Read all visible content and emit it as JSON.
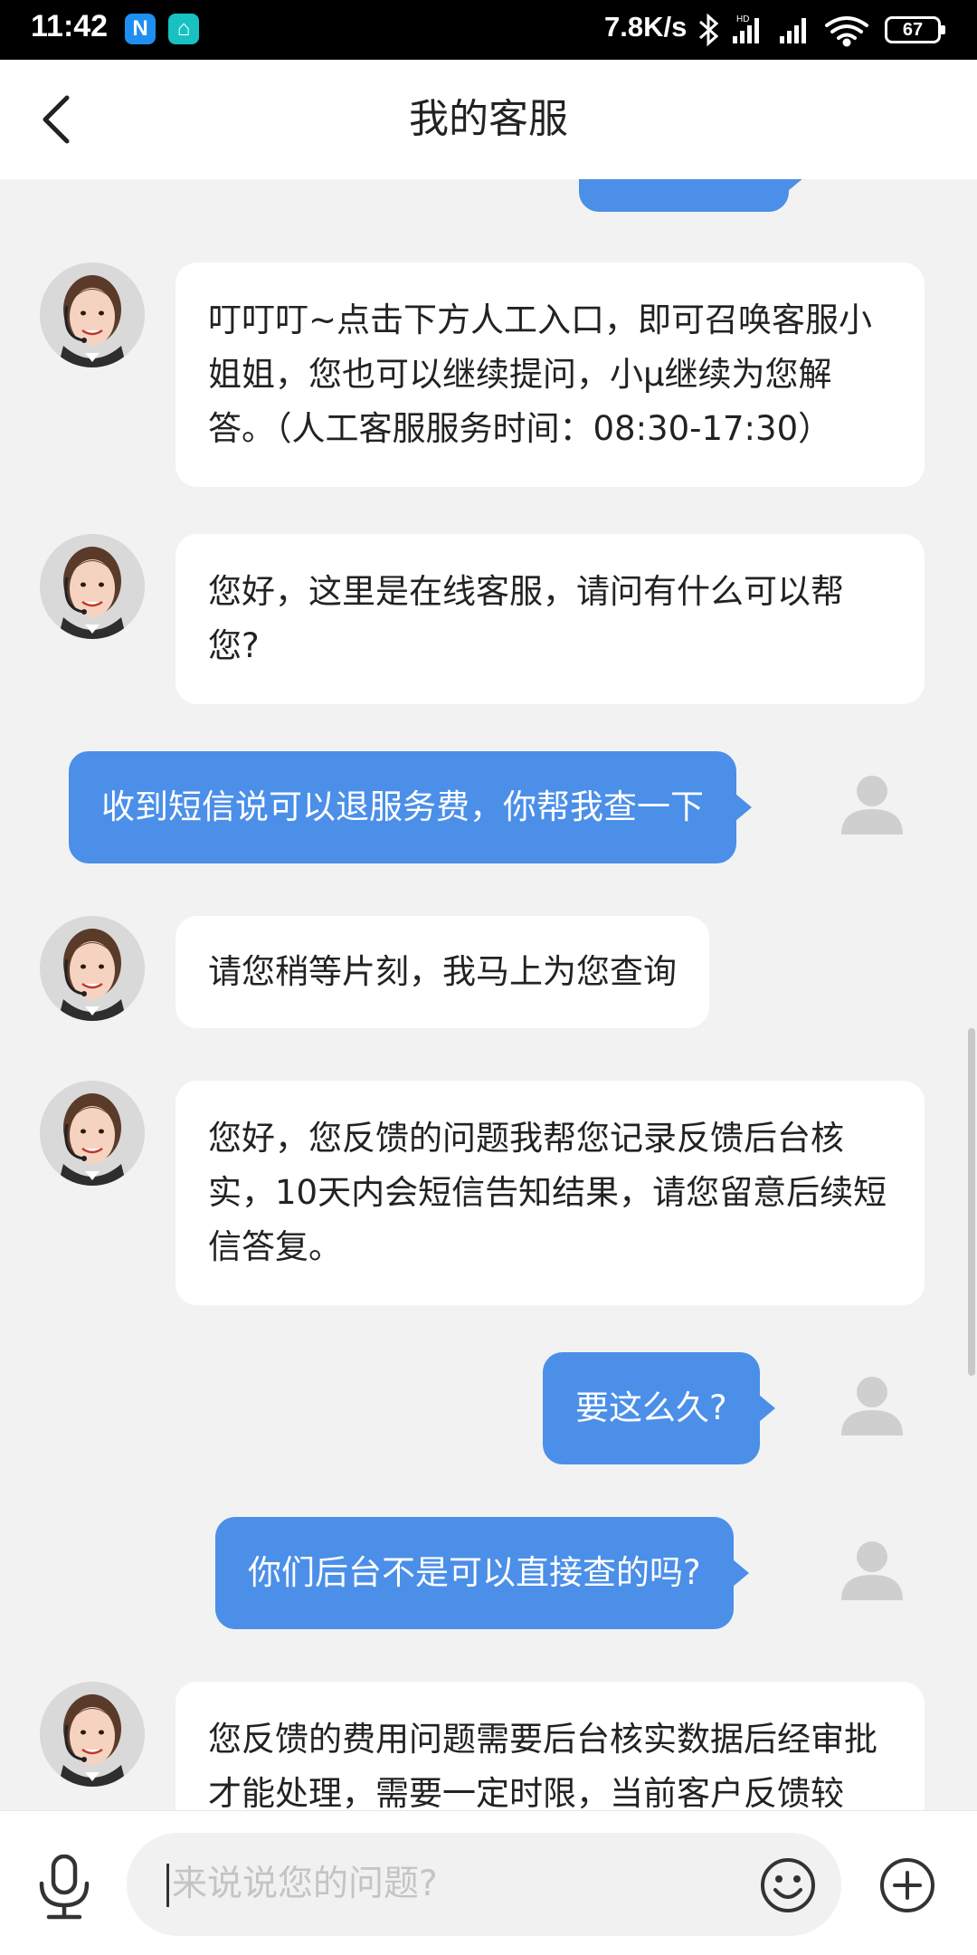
{
  "status_bar": {
    "time": "11:42",
    "app_icons": [
      "N",
      "⌂"
    ],
    "net_speed": "7.8K/s",
    "battery": "67"
  },
  "header": {
    "back_icon": "chevron-left-icon",
    "title": "我的客服"
  },
  "messages": [
    {
      "side": "in",
      "text": "叮叮叮~点击下方人工入口，即可召唤客服小姐姐，您也可以继续提问，小μ继续为您解答。（人工客服服务时间：08:30-17:30）"
    },
    {
      "side": "in",
      "text": "您好，这里是在线客服，请问有什么可以帮您?"
    },
    {
      "side": "out",
      "text": "收到短信说可以退服务费，你帮我查一下"
    },
    {
      "side": "in",
      "text": "请您稍等片刻，我马上为您查询"
    },
    {
      "side": "in",
      "text": "您好，您反馈的问题我帮您记录反馈后台核实，10天内会短信告知结果，请您留意后续短信答复。"
    },
    {
      "side": "out",
      "text": "要这么久?"
    },
    {
      "side": "out",
      "text": "你们后台不是可以直接查的吗?"
    },
    {
      "side": "in",
      "text": "您反馈的费用问题需要后台核实数据后经审批才能处理，需要一定时限，当前客户反馈较"
    }
  ],
  "input_bar": {
    "placeholder": "来说说您的问题?",
    "mic_icon": "microphone-icon",
    "emoji_icon": "smiley-icon",
    "plus_icon": "plus-circle-icon"
  },
  "colors": {
    "bubble_out": "#4b8fe8",
    "bubble_in": "#ffffff",
    "chat_bg": "#f2f2f2"
  }
}
